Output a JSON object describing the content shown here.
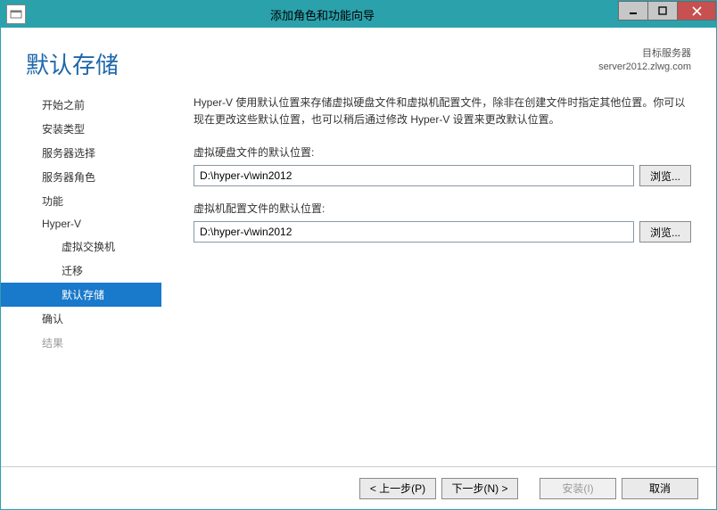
{
  "titlebar": {
    "title": "添加角色和功能向导"
  },
  "header": {
    "heading": "默认存储",
    "target_label": "目标服务器",
    "target_value": "server2012.zlwg.com"
  },
  "sidebar": {
    "items": [
      {
        "label": "开始之前",
        "lvl": 1,
        "selected": false,
        "disabled": false
      },
      {
        "label": "安装类型",
        "lvl": 1,
        "selected": false,
        "disabled": false
      },
      {
        "label": "服务器选择",
        "lvl": 1,
        "selected": false,
        "disabled": false
      },
      {
        "label": "服务器角色",
        "lvl": 1,
        "selected": false,
        "disabled": false
      },
      {
        "label": "功能",
        "lvl": 1,
        "selected": false,
        "disabled": false
      },
      {
        "label": "Hyper-V",
        "lvl": 1,
        "selected": false,
        "disabled": false
      },
      {
        "label": "虚拟交换机",
        "lvl": 2,
        "selected": false,
        "disabled": false
      },
      {
        "label": "迁移",
        "lvl": 2,
        "selected": false,
        "disabled": false
      },
      {
        "label": "默认存储",
        "lvl": 2,
        "selected": true,
        "disabled": false
      },
      {
        "label": "确认",
        "lvl": 1,
        "selected": false,
        "disabled": false
      },
      {
        "label": "结果",
        "lvl": 1,
        "selected": false,
        "disabled": true
      }
    ]
  },
  "main": {
    "description": "Hyper-V 使用默认位置来存储虚拟硬盘文件和虚拟机配置文件，除非在创建文件时指定其他位置。你可以现在更改这些默认位置，也可以稍后通过修改 Hyper-V 设置来更改默认位置。",
    "vhd_label": "虚拟硬盘文件的默认位置:",
    "vhd_value": "D:\\hyper-v\\win2012",
    "vm_label": "虚拟机配置文件的默认位置:",
    "vm_value": "D:\\hyper-v\\win2012",
    "browse_label": "浏览..."
  },
  "footer": {
    "prev": "< 上一步(P)",
    "next": "下一步(N) >",
    "install": "安装(I)",
    "cancel": "取消"
  }
}
